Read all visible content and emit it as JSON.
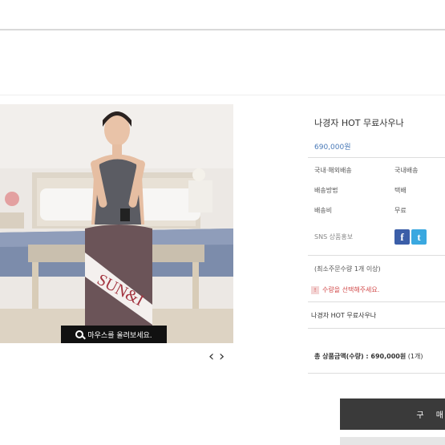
{
  "product": {
    "title": "나경자 HOT 무료사우나",
    "price": "690,000원",
    "photo_brand": "SUN&I",
    "hover_hint": "마우스를 올려보세요.",
    "pager_prev": "‹",
    "pager_next": "›"
  },
  "details": {
    "rows": [
      {
        "label": "국내·해외배송",
        "value": "국내배송"
      },
      {
        "label": "배송방법",
        "value": "택배"
      },
      {
        "label": "배송비",
        "value": "무료"
      },
      {
        "label": "SNS 상품홍보",
        "value": ""
      }
    ],
    "sns": {
      "facebook": "f",
      "twitter": "t"
    },
    "min_order": "(최소주문수량 1개 이상)",
    "notice": "수량을 선택해주세요.",
    "notice_icon": "!",
    "selected_item": "나경자 HOT 무료사우나",
    "total_label": "총 상품금액(수량) : ",
    "total_value": "690,000원",
    "total_qty": " (1개)",
    "buy_label": "구 매"
  },
  "colors": {
    "price": "#4a7ab8",
    "notice": "#d24b4b",
    "buy_button": "#3a3a3a",
    "facebook": "#3b5ea8",
    "twitter": "#3aa8e0"
  }
}
